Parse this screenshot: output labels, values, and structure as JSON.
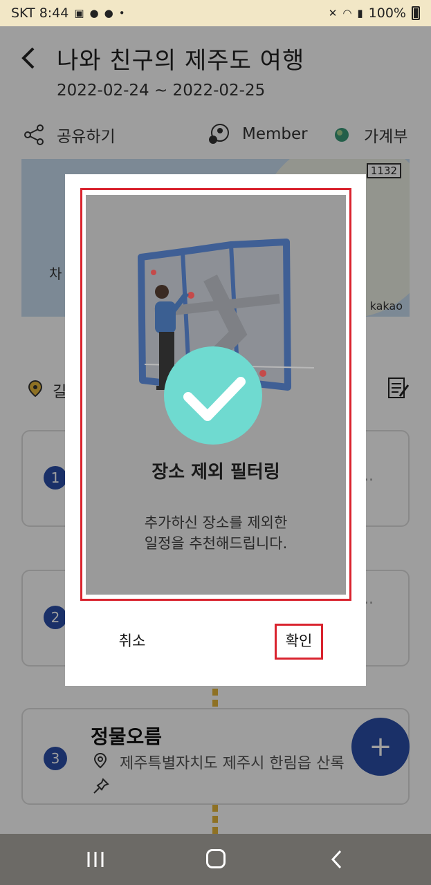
{
  "status_bar": {
    "carrier_time": "SKT 8:44",
    "battery": "100%"
  },
  "header": {
    "title": "나와 친구의 제주도 여행",
    "dates": "2022-02-24 ~ 2022-02-25"
  },
  "actions": {
    "share_label": "공유하기",
    "member_label": "Member",
    "ledger_label": "가계부"
  },
  "map": {
    "road_number": "1132",
    "attribution": "kakao",
    "partial_label": "차"
  },
  "place_row": {
    "partial_text": "길"
  },
  "cards": [
    {
      "number": "1",
      "ellipsis": ".."
    },
    {
      "number": "2",
      "ellipsis": ".."
    },
    {
      "number": "3",
      "title": "정물오름",
      "address": "제주특별자치도 제주시 한림읍 산록"
    }
  ],
  "fab": {
    "label": "+"
  },
  "dialog": {
    "heading": "장소 제외 필터링",
    "line1": "추가하신 장소를 제외한",
    "line2": "일정을 추천해드립니다.",
    "cancel_label": "취소",
    "confirm_label": "확인"
  },
  "colors": {
    "accent_blue": "#2a4ea8",
    "check_teal": "#6fdad0",
    "highlight_red": "#d9232e",
    "route_yellow": "#e6b73a"
  }
}
